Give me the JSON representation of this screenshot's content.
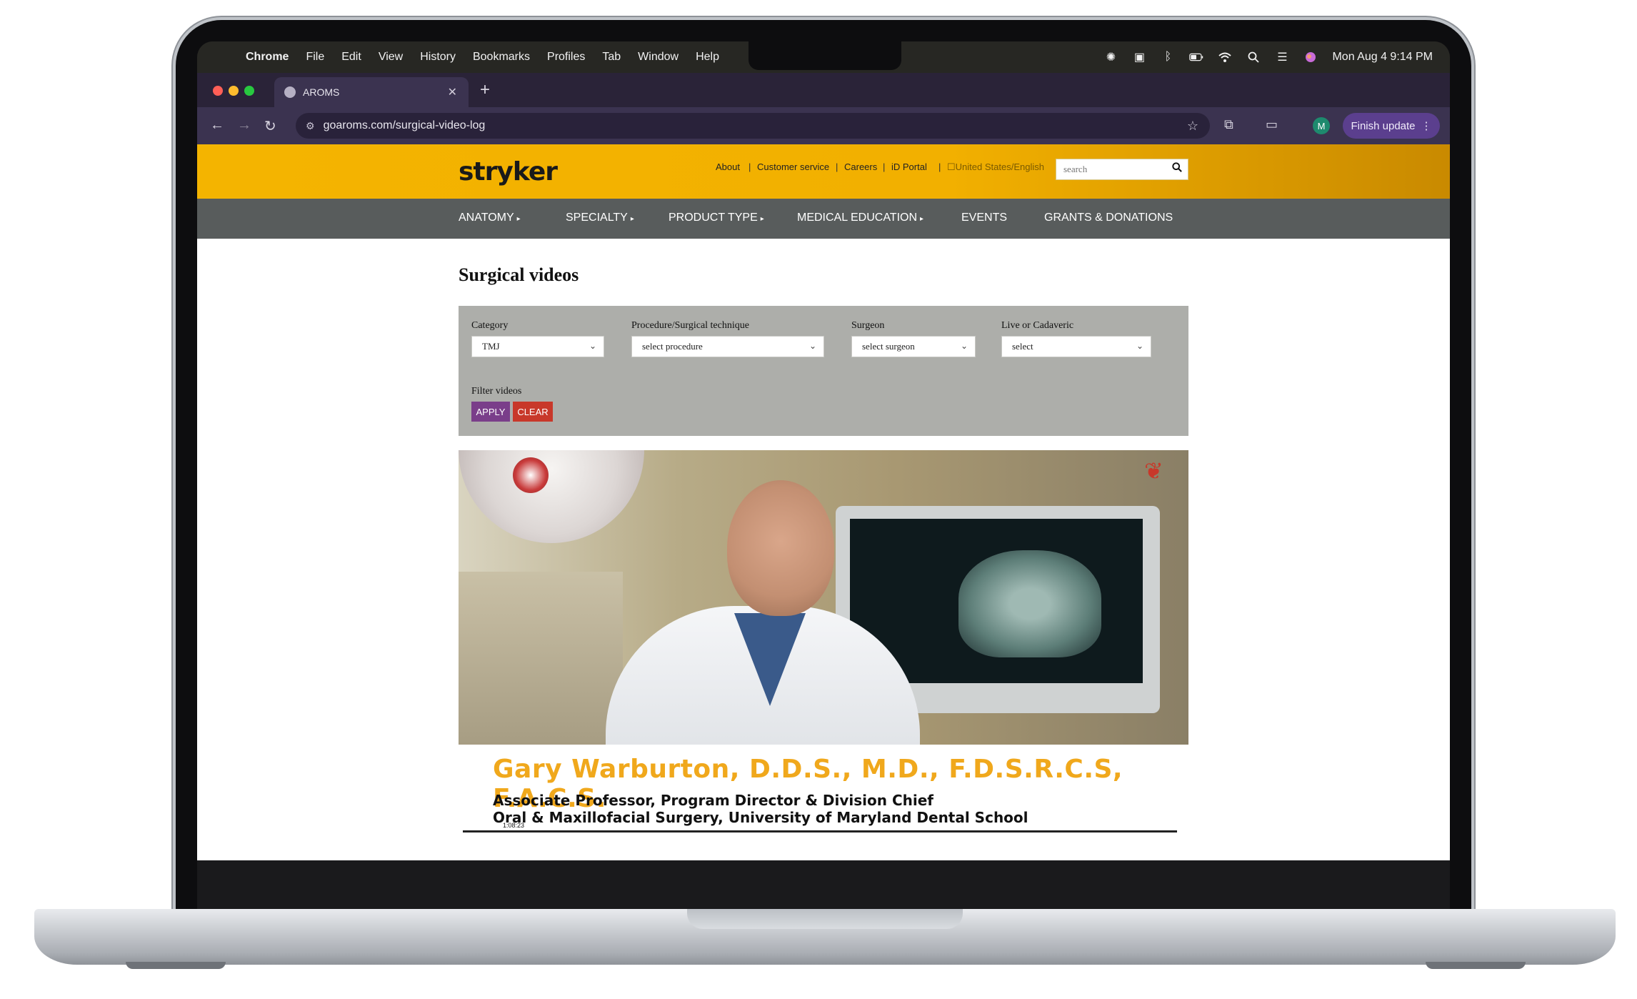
{
  "menubar": {
    "items": [
      "Chrome",
      "File",
      "Edit",
      "View",
      "History",
      "Bookmarks",
      "Profiles",
      "Tab",
      "Window",
      "Help"
    ],
    "datetime": "Mon Aug 4  9:14 PM"
  },
  "browser": {
    "tab_title": "AROMS",
    "url": "goaroms.com/surgical-video-log",
    "profile_initial": "M",
    "finish_update": "Finish update"
  },
  "site": {
    "logo": "stryker",
    "utility_links": [
      "About",
      "Customer service",
      "Careers",
      "iD Portal"
    ],
    "region": "United States/English",
    "search_placeholder": "search",
    "nav": [
      "Anatomy",
      "Specialty",
      "Product type",
      "Medical education",
      "Events",
      "Grants & donations"
    ]
  },
  "main": {
    "title": "Surgical videos",
    "filters": {
      "category_label": "Category",
      "category_value": "TMJ",
      "procedure_label": "Procedure/Surgical technique",
      "procedure_value": "select procedure",
      "surgeon_label": "Surgeon",
      "surgeon_value": "select surgeon",
      "live_label": "Live or Cadaveric",
      "live_value": "select",
      "filter_title": "Filter videos",
      "apply": "APPLY",
      "clear": "CLEAR"
    },
    "video": {
      "name": "Gary Warburton, D.D.S., M.D., F.D.S.R.C.S, F.A.C.S.",
      "line1": "Associate Professor, Program Director & Division Chief",
      "line2": "Oral & Maxillofacial Surgery, University of Maryland Dental School",
      "timestamp": "1:08:23"
    }
  },
  "colors": {
    "brand_yellow": "#f4b400",
    "nav_gray": "#585c5c",
    "apply_purple": "#7a3e8a",
    "clear_red": "#c8382a",
    "name_gold": "#f0a81c"
  }
}
